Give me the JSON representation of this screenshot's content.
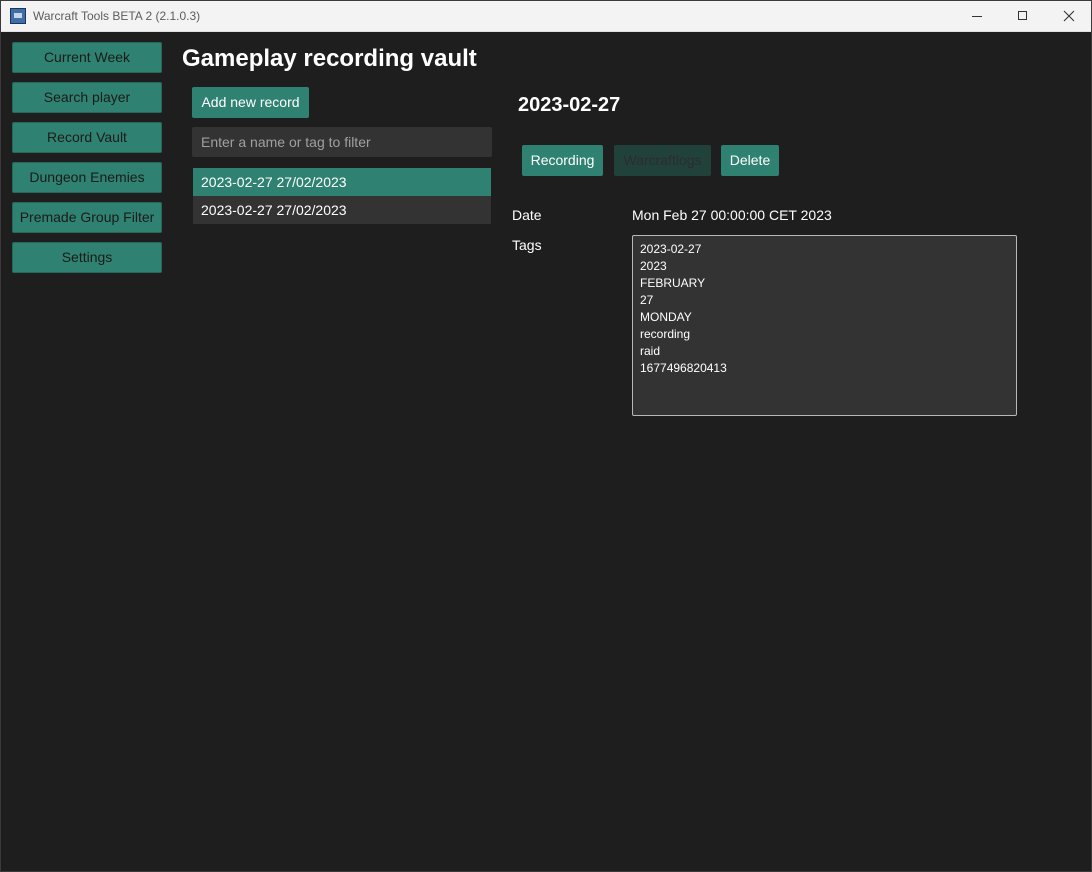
{
  "window": {
    "title": "Warcraft Tools BETA 2 (2.1.0.3)"
  },
  "sidebar": {
    "items": [
      {
        "label": "Current Week"
      },
      {
        "label": "Search player"
      },
      {
        "label": "Record Vault"
      },
      {
        "label": "Dungeon Enemies"
      },
      {
        "label": "Premade Group Filter"
      },
      {
        "label": "Settings"
      }
    ]
  },
  "main": {
    "title": "Gameplay recording vault",
    "add_button_label": "Add new record",
    "filter_placeholder": "Enter a name or tag to filter",
    "filter_value": "",
    "records": [
      {
        "label": "2023-02-27 27/02/2023",
        "selected": true
      },
      {
        "label": "2023-02-27 27/02/2023",
        "selected": false
      }
    ]
  },
  "detail": {
    "title": "2023-02-27",
    "buttons": {
      "recording": "Recording",
      "warcraftlogs": "Warcraftlogs",
      "delete": "Delete"
    },
    "date_label": "Date",
    "date_value": "Mon Feb 27 00:00:00 CET 2023",
    "tags_label": "Tags",
    "tags": [
      "2023-02-27",
      "2023",
      "FEBRUARY",
      "27",
      "MONDAY",
      "recording",
      "raid",
      "1677496820413"
    ]
  },
  "colors": {
    "accent": "#2f8271",
    "accent_disabled": "#21413b",
    "background": "#1e1e1e",
    "surface": "#333333"
  }
}
